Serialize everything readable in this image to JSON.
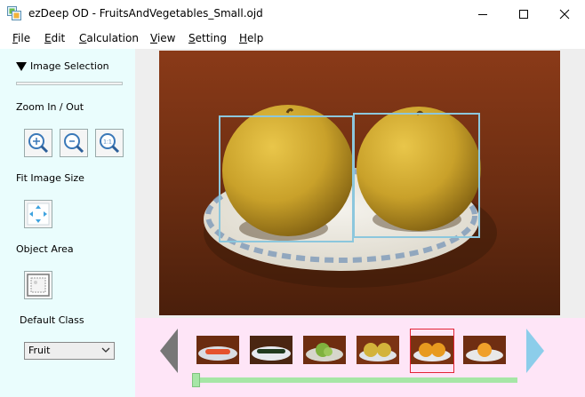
{
  "window": {
    "title": "ezDeep OD - FruitsAndVegetables_Small.ojd",
    "minimize_icon": "minimize-icon",
    "maximize_icon": "maximize-icon",
    "close_icon": "close-icon"
  },
  "menu": {
    "items": [
      {
        "mnemonic": "F",
        "rest": "ile"
      },
      {
        "mnemonic": "E",
        "rest": "dit"
      },
      {
        "mnemonic": "C",
        "rest": "alculation"
      },
      {
        "mnemonic": "V",
        "rest": "iew"
      },
      {
        "mnemonic": "S",
        "rest": "etting"
      },
      {
        "mnemonic": "H",
        "rest": "elp"
      }
    ]
  },
  "sidebar": {
    "image_selection_label": "Image Selection",
    "zoom_label": "Zoom In / Out",
    "zoom_in_icon": "zoom-in-icon",
    "zoom_out_icon": "zoom-out-icon",
    "zoom_actual_icon": "zoom-actual-size-icon",
    "zoom_actual_text": "1:1",
    "fit_label": "Fit Image Size",
    "fit_icon": "fit-image-icon",
    "object_area_label": "Object Area",
    "object_area_icon": "object-area-icon",
    "default_class_label": "Default Class",
    "default_class_value": "Fruit"
  },
  "thumbnails": {
    "items": [
      "thumbnail-carrot",
      "thumbnail-cucumber",
      "thumbnail-greens",
      "thumbnail-pears-yellow",
      "thumbnail-oranges",
      "thumbnail-mandarin"
    ],
    "selected_index": 4,
    "slider_position": 0.0
  },
  "colors": {
    "sidebar_bg": "#eafdfd",
    "strip_bg": "#fee5f7",
    "bbox": "#8cc7dd",
    "selection_frame": "#e32335",
    "slider": "#a6e6a6",
    "left_arrow": "#777777",
    "right_arrow": "#8ccdea"
  }
}
